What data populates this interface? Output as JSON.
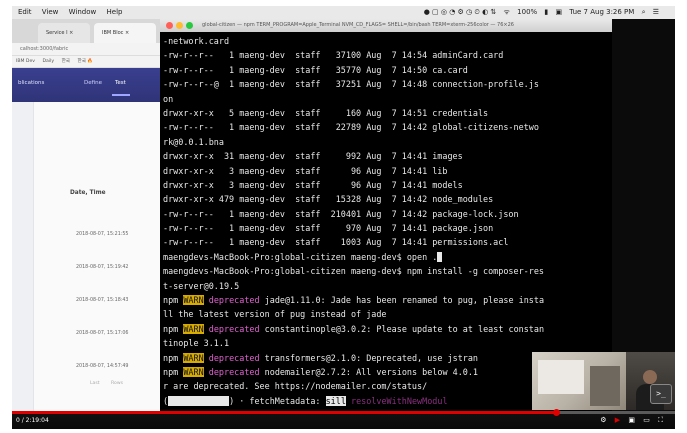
{
  "menubar": {
    "items": [
      "Edit",
      "View",
      "Window",
      "Help"
    ],
    "battery": "100%",
    "clock": "Tue 7 Aug 3:26 PM"
  },
  "browser": {
    "tabs": [
      "Service I ×",
      "IBM Bloc ×"
    ],
    "url": "calhost:3000/fabric",
    "bookmarks": [
      "IBM Dev",
      "Daily",
      "한국",
      "한국 🔥"
    ],
    "app_brand": "blications",
    "app_tabs": [
      "Define",
      "Test"
    ],
    "date_header": "Date, Time",
    "dates": [
      "2018-08-07, 15:21:55",
      "2018-08-07, 15:19:42",
      "2018-08-07, 15:18:43",
      "2018-08-07, 15:17:06",
      "2018-08-07, 14:57:49"
    ],
    "footer": [
      "Last",
      "Rows"
    ]
  },
  "terminal": {
    "title": "global-citizen — npm TERM_PROGRAM=Apple_Terminal NVM_CD_FLAGS= SHELL=/bin/bash TERM=xterm-256color — 76×26",
    "lines": {
      "l1": "-network.card",
      "l2": "-rw-r--r--   1 maeng-dev  staff   37100 Aug  7 14:54 adminCard.card",
      "l3": "-rw-r--r--   1 maeng-dev  staff   35770 Aug  7 14:50 ca.card",
      "l4": "-rw-r--r--@  1 maeng-dev  staff   37251 Aug  7 14:48 connection-profile.js",
      "l5": "on",
      "l6": "drwxr-xr-x   5 maeng-dev  staff     160 Aug  7 14:51 credentials",
      "l7": "-rw-r--r--   1 maeng-dev  staff   22789 Aug  7 14:42 global-citizens-netwo",
      "l8": "rk@0.0.1.bna",
      "l9": "drwxr-xr-x  31 maeng-dev  staff     992 Aug  7 14:41 images",
      "l10": "drwxr-xr-x   3 maeng-dev  staff      96 Aug  7 14:41 lib",
      "l11": "drwxr-xr-x   3 maeng-dev  staff      96 Aug  7 14:41 models",
      "l12": "drwxr-xr-x 479 maeng-dev  staff   15328 Aug  7 14:42 node_modules",
      "l13": "-rw-r--r--   1 maeng-dev  staff  210401 Aug  7 14:42 package-lock.json",
      "l14": "-rw-r--r--   1 maeng-dev  staff     970 Aug  7 14:41 package.json",
      "l15": "-rw-r--r--   1 maeng-dev  staff    1003 Aug  7 14:41 permissions.acl",
      "l16_prompt": "maengdevs-MacBook-Pro:global-citizen maeng-dev$ open .",
      "l16_cursor": " ",
      "l17": "maengdevs-MacBook-Pro:global-citizen maeng-dev$ npm install -g composer-res",
      "l18": "t-server@0.19.5",
      "w1_text": " jade@1.11.0: Jade has been renamed to pug, please insta",
      "w1_cont": "ll the latest version of pug instead of jade",
      "w2_text": " constantinople@3.0.2: Please update to at least constan",
      "w2_cont": "tinople 3.1.1",
      "w3_text": " transformers@2.1.0: Deprecated, use jstran",
      "w4_text": " nodemailer@2.7.2: All versions below 4.0.1",
      "w4_cont": "r are deprecated. See https://nodemailer.com/status/",
      "npm": "npm",
      "warn": "WARN",
      "deprecated": "deprecated",
      "progress_open": "(",
      "progress_bar": "            ",
      "progress_mid": ") · fetchMetadata: ",
      "sill": "sill",
      "progress_tail": " resolveWithNewModul"
    }
  },
  "player": {
    "time": "0 / 2:19:04",
    "progress_fraction": 0.82,
    "icons": [
      "settings-icon",
      "youtube-logo-icon",
      "miniplayer-icon",
      "theater-mode-icon",
      "fullscreen-icon"
    ]
  }
}
